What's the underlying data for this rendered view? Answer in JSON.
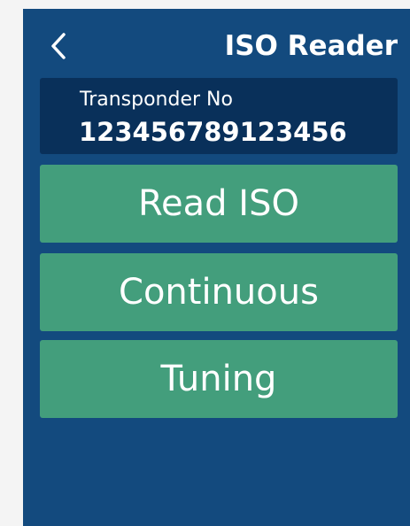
{
  "header": {
    "back_icon": "chevron-left-icon",
    "title": "ISO Reader"
  },
  "transponder": {
    "label": "Transponder No",
    "value": "123456789123456"
  },
  "actions": [
    {
      "label": "Read ISO"
    },
    {
      "label": "Continuous"
    },
    {
      "label": "Tuning"
    }
  ],
  "colors": {
    "background": "#134a7e",
    "info_panel": "#09305a",
    "button": "#439e7c",
    "text": "#ffffff"
  }
}
